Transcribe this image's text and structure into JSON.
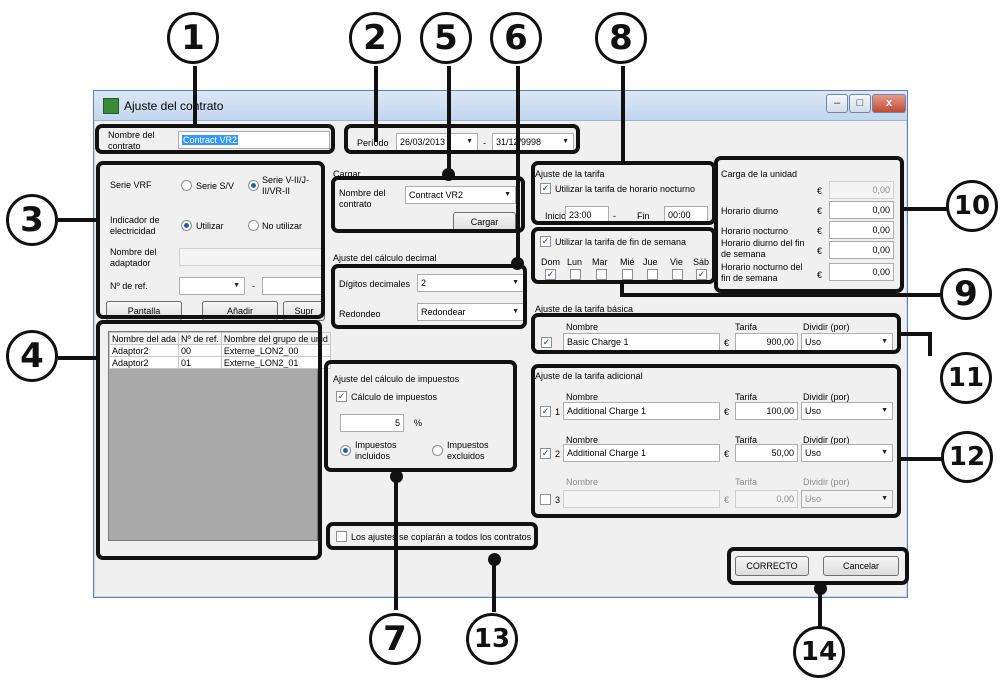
{
  "window": {
    "title": "Ajuste del contrato",
    "controls": [
      "–",
      "□",
      "x"
    ]
  },
  "contract": {
    "name_label": "Nombre del contrato",
    "name_value": "Contract VR2"
  },
  "period": {
    "label": "Período",
    "start": "26/03/2013",
    "separator": "-",
    "end": "31/12/9998"
  },
  "left": {
    "serie_label": "Serie VRF",
    "serie_options": [
      "Serie S/V",
      "Serie V-II/J-II/VR-II"
    ],
    "indicador_label": "Indicador de electricidad",
    "indicador_options": [
      "Utilizar",
      "No utilizar"
    ],
    "adaptador_label": "Nombre del adaptador",
    "ref_label": "Nº de ref.",
    "ref_sep": "-",
    "buttons": [
      "Pantalla",
      "Añadir",
      "Supr"
    ],
    "grid": {
      "headers": [
        "Nombre del ada",
        "Nº de ref.",
        "Nombre del grupo de unid"
      ],
      "rows": [
        [
          "Adaptor2",
          "00",
          "Externe_LON2_00"
        ],
        [
          "Adaptor2",
          "01",
          "Externe_LON2_01"
        ]
      ]
    }
  },
  "cargar": {
    "title": "Cargar",
    "name_label": "Nombre del contrato",
    "name_value": "Contract VR2",
    "button": "Cargar"
  },
  "decimal": {
    "title": "Ajuste del cálculo decimal",
    "digits_label": "Dígitos decimales",
    "digits_value": "2",
    "round_label": "Redondeo",
    "round_value": "Redondear"
  },
  "tax": {
    "title": "Ajuste del cálculo de impuestos",
    "check_label": "Cálculo de impuestos",
    "value": "5",
    "unit": "%",
    "options": [
      "Impuestos incluidos",
      "Impuestos excluidos"
    ]
  },
  "copy_all": {
    "label": "Los ajustes se copiarán a todos los contratos"
  },
  "tarifa": {
    "title": "Ajuste de la tarifa",
    "night_label": "Utilizar la tarifa de horario nocturno",
    "inicio_label": "Inicio",
    "inicio_value": "23:00",
    "sep": "-",
    "fin_label": "Fin",
    "fin_value": "00:00",
    "weekend_label": "Utilizar la tarifa de fin de semana",
    "days": [
      "Dom",
      "Lun",
      "Mar",
      "Mié",
      "Jue",
      "Vie",
      "Sáb"
    ],
    "days_checked": [
      true,
      false,
      false,
      false,
      false,
      false,
      true
    ]
  },
  "carga": {
    "title": "Carga de la unidad",
    "currency": "€",
    "rows": [
      {
        "label": "",
        "value": "0,00"
      },
      {
        "label": "Horario diurno",
        "value": "0,00"
      },
      {
        "label": "Horario nocturno",
        "value": "0,00"
      },
      {
        "label": "Horario diurno del fin de semana",
        "value": "0,00"
      },
      {
        "label": "Horario nocturno del fin de semana",
        "value": "0,00"
      }
    ]
  },
  "basica": {
    "title": "Ajuste de la tarifa básica",
    "col_nombre": "Nombre",
    "col_tarifa": "Tarifa",
    "col_dividir": "Dividir (por)",
    "name": "Basic Charge 1",
    "currency": "€",
    "value": "900,00",
    "divide": "Uso"
  },
  "adicional": {
    "title": "Ajuste de la tarifa adicional",
    "col_nombre": "Nombre",
    "col_tarifa": "Tarifa",
    "col_dividir": "Dividir (por)",
    "currency": "€",
    "rows": [
      {
        "index": "1",
        "name": "Additional Charge 1",
        "value": "100,00",
        "divide": "Uso"
      },
      {
        "index": "2",
        "name": "Additional Charge 1",
        "value": "50,00",
        "divide": "Uso"
      },
      {
        "index": "3",
        "name": "",
        "value": "0,00",
        "divide": "Uso"
      }
    ]
  },
  "footer": {
    "ok": "CORRECTO",
    "cancel": "Cancelar"
  },
  "callouts": {
    "c1": "1",
    "c2": "2",
    "c3": "3",
    "c4": "4",
    "c5": "5",
    "c6": "6",
    "c7": "7",
    "c8": "8",
    "c9": "9",
    "c10": "10",
    "c11": "11",
    "c12": "12",
    "c13": "13",
    "c14": "14"
  },
  "colors": {
    "title_gradient_top": "#dbe7f6",
    "window_bg": "#f0f0f0",
    "annotation": "#111111",
    "selection": "#3399ff"
  }
}
